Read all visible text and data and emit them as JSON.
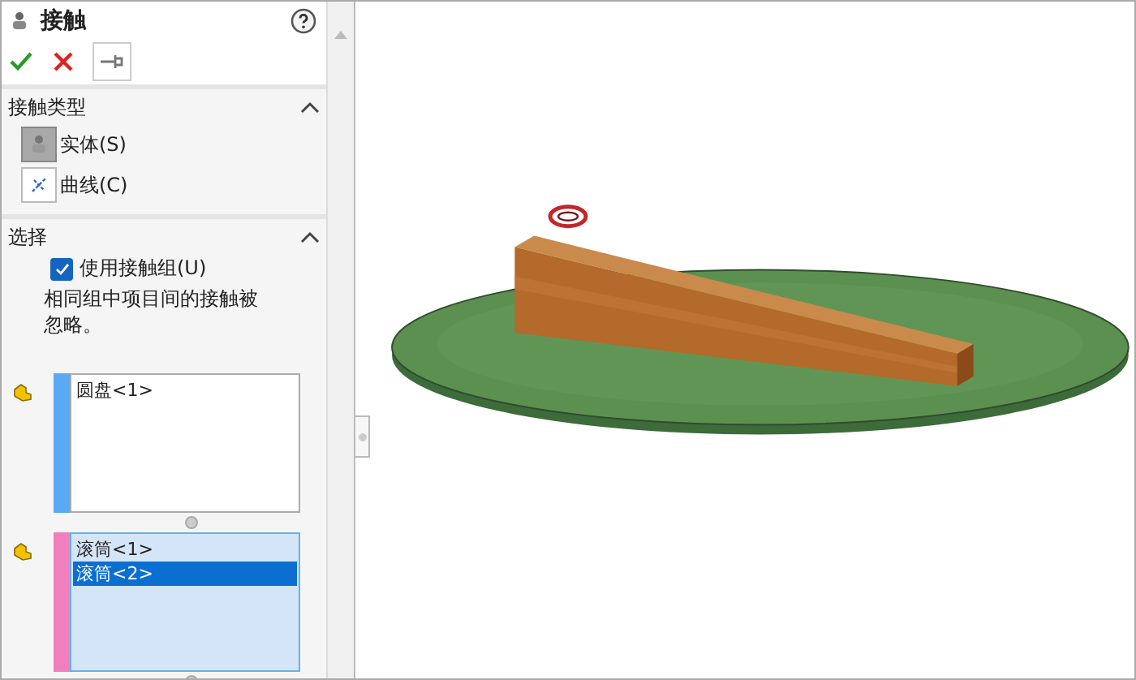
{
  "panel": {
    "title": "接触"
  },
  "contact_type": {
    "title": "接触类型",
    "expanded": true,
    "options": [
      {
        "kind": "solid",
        "label": "实体(S)",
        "selected": true
      },
      {
        "kind": "curve",
        "label": "曲线(C)",
        "selected": false
      }
    ]
  },
  "selection": {
    "title": "选择",
    "expanded": true,
    "checkbox": {
      "label": "使用接触组(U)",
      "checked": true
    },
    "note": "相同组中项目间的接触被忽略。",
    "groups": [
      {
        "color": "#5aa9f5",
        "active": false,
        "items": [
          {
            "label": "圆盘<1>",
            "selected": false
          }
        ]
      },
      {
        "color": "#f27fbd",
        "active": true,
        "items": [
          {
            "label": "滚筒<1>",
            "selected": false
          },
          {
            "label": "滚筒<2>",
            "selected": true
          }
        ]
      }
    ]
  }
}
